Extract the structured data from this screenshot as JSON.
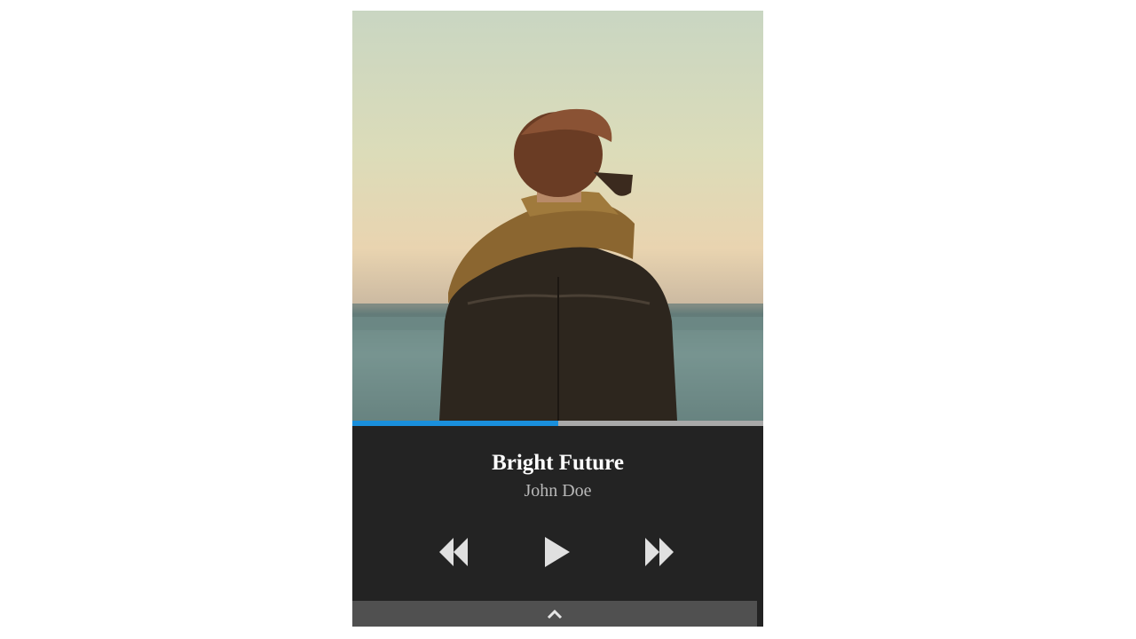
{
  "track": {
    "title": "Bright Future",
    "artist": "John Doe"
  },
  "playback": {
    "progress_fraction": 0.5
  },
  "icons": {
    "rewind": "rewind-icon",
    "play": "play-icon",
    "fast_forward": "fast-forward-icon",
    "expand": "chevron-up-icon"
  },
  "colors": {
    "accent": "#1a8fdc",
    "player_background": "#232323",
    "drawer_background": "#505050",
    "title_text": "#ffffff",
    "artist_text": "#b9b9b9"
  }
}
